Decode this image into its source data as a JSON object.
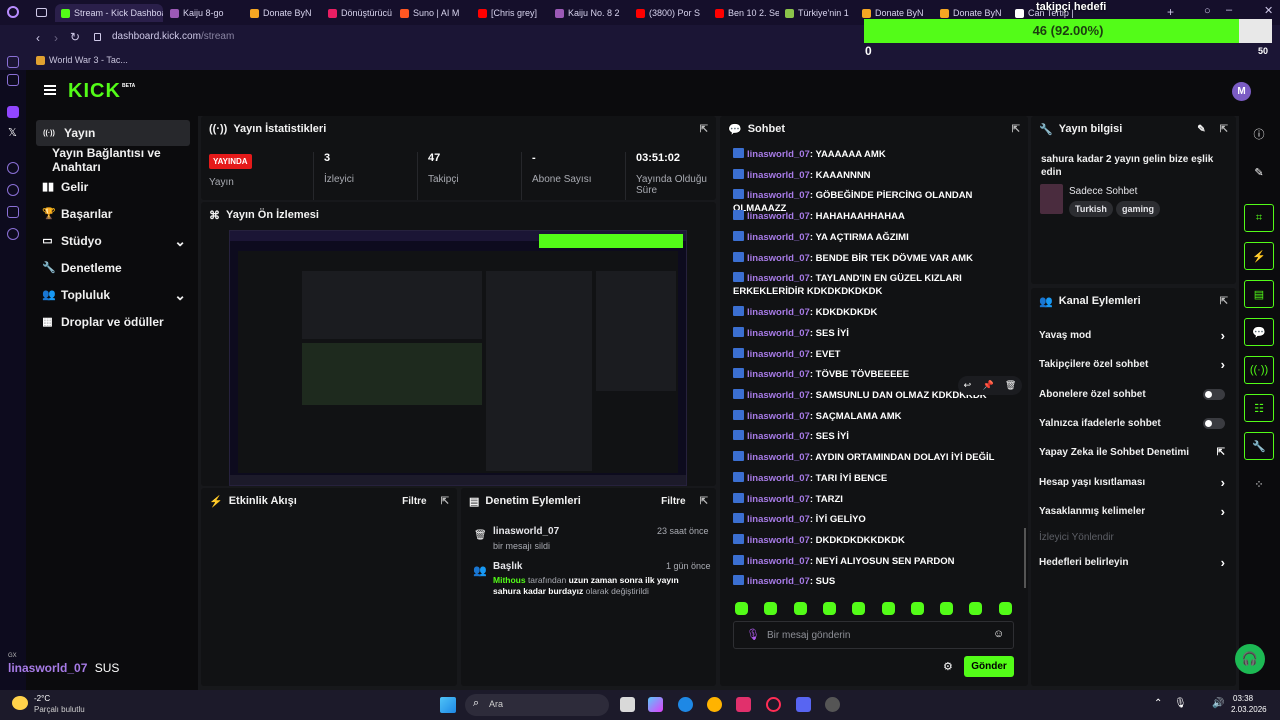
{
  "browser": {
    "tabs": [
      {
        "label": "Stream - Kick Dashboa",
        "color": "#53fc18",
        "active": true
      },
      {
        "label": "Kaiju 8-go",
        "color": "#9b59b6"
      },
      {
        "label": "Donate ByN",
        "color": "#f5a623"
      },
      {
        "label": "Dönüştürücü",
        "color": "#e91e63"
      },
      {
        "label": "Suno | AI M",
        "color": "#ff5722"
      },
      {
        "label": "[Chris grey]",
        "color": "#ff0000"
      },
      {
        "label": "Kaiju No. 8 2",
        "color": "#9b59b6"
      },
      {
        "label": "(3800) Por S",
        "color": "#ff0000"
      },
      {
        "label": "Ben 10 2. Se",
        "color": "#ff0000"
      },
      {
        "label": "Türkiye'nin 1",
        "color": "#8bc34a"
      },
      {
        "label": "Donate ByN",
        "color": "#f5a623"
      },
      {
        "label": "Donate ByN",
        "color": "#f5a623"
      },
      {
        "label": "Can Tertip |",
        "color": "#ffffff"
      }
    ],
    "url_host": "dashboard.kick.com",
    "url_path": "/stream",
    "bookmark": "World War 3 - Tac..."
  },
  "goal_overlay": {
    "title": "takipçi hedefi",
    "text": "46 (92.00%)",
    "min": "0",
    "max": "50",
    "progress": 0.92
  },
  "header": {
    "logo": "KICK",
    "beta": "BETA",
    "avatar_letter": "M"
  },
  "sidenav": {
    "items": [
      {
        "label": "Yayın",
        "icon": "broadcast-icon",
        "active": true
      },
      {
        "label": "Yayın Bağlantısı ve Anahtarı",
        "sub": true
      },
      {
        "label": "Gelir",
        "icon": "revenue-icon"
      },
      {
        "label": "Başarılar",
        "icon": "trophy-icon"
      },
      {
        "label": "Stüdyo",
        "icon": "studio-icon",
        "expand": true
      },
      {
        "label": "Denetleme",
        "icon": "wrench-icon"
      },
      {
        "label": "Topluluk",
        "icon": "community-icon",
        "expand": true
      },
      {
        "label": "Droplar ve ödüller",
        "icon": "drops-icon"
      }
    ]
  },
  "stats": {
    "title": "Yayın İstatistikleri",
    "live_badge": "YAYINDA",
    "items": [
      {
        "value": "",
        "label": "Yayın"
      },
      {
        "value": "3",
        "label": "İzleyici"
      },
      {
        "value": "47",
        "label": "Takipçi"
      },
      {
        "value": "-",
        "label": "Abone Sayısı"
      },
      {
        "value": "03:51:02",
        "label": "Yayında Olduğu Süre"
      }
    ]
  },
  "preview": {
    "title": "Yayın Ön İzlemesi"
  },
  "activity": {
    "title": "Etkinlik Akışı",
    "filter": "Filtre"
  },
  "moderation": {
    "title": "Denetim Eylemleri",
    "filter": "Filtre",
    "entries": [
      {
        "user": "linasworld_07",
        "time": "23 saat önce",
        "detail": "bir mesajı sildi"
      },
      {
        "user": "Başlık",
        "time": "1 gün önce",
        "actor": "Mithous",
        "mid": " tarafından ",
        "bold": "uzun zaman sonra ilk yayın sahura kadar burdayız",
        "tail": " olarak değiştirildi"
      }
    ]
  },
  "chat": {
    "title": "Sohbet",
    "username": "linasworld_07",
    "messages": [
      "YAAAAAA AMK",
      "KAAANNNN",
      "GÖBEĞİNDE PİERCİNG OLANDAN OLMAAAZZ",
      "HAHAHAAHHAHAA",
      "YA AÇTIRMA AĞZIMI",
      "BENDE BİR TEK DÖVME VAR AMK",
      "TAYLAND'IN EN GÜZEL KIZLARI ERKEKLERİDİR KDKDKDKDKDK",
      "KDKDKDKDK",
      "SES İYİ",
      "EVET",
      "TÖVBE TÖVBEEEEE",
      "SAMSUNLU DAN OLMAZ KDKDKKDK",
      "SAÇMALAMA AMK",
      "SES İYİ",
      "AYDIN ORTAMINDAN DOLAYI İYİ DEĞİL",
      "TARI İYİ BENCE",
      "TARZI",
      "İYİ GELİYO",
      "DKDKDKDKKDKDK",
      "NEYİ ALIYOSUN SEN PARDON",
      "SUS"
    ],
    "input_placeholder": "Bir mesaj gönderin",
    "send": "Gönder"
  },
  "stream_info": {
    "title": "Yayın bilgisi",
    "stream_title": "sahura kadar 2 yayın gelin bize eşlik edin",
    "category": "Sadece Sohbet",
    "tags": [
      "Turkish",
      "gaming"
    ]
  },
  "channel_actions": {
    "title": "Kanal Eylemleri",
    "rows": [
      {
        "label": "Yavaş mod",
        "type": "chevron"
      },
      {
        "label": "Takipçilere özel sohbet",
        "type": "chevron"
      },
      {
        "label": "Abonelere özel sohbet",
        "type": "toggle"
      },
      {
        "label": "Yalnızca ifadelerle sohbet",
        "type": "toggle"
      },
      {
        "label": "Yapay Zeka ile Sohbet Denetimi",
        "type": "external"
      },
      {
        "label": "Hesap yaşı kısıtlaması",
        "type": "chevron"
      },
      {
        "label": "Yasaklanmış kelimeler",
        "type": "chevron"
      },
      {
        "label": "İzleyici Yönlendir",
        "type": "disabled"
      },
      {
        "label": "Hedefleri belirleyin",
        "type": "chevron"
      }
    ]
  },
  "bottom_overlay": {
    "tag": "GX",
    "user": "linasworld_07",
    "msg": "SUS"
  },
  "taskbar": {
    "temp": "-2°C",
    "weather": "Parçalı bulutlu",
    "search": "Ara",
    "time": "03:38",
    "date": "2.03.2026"
  }
}
